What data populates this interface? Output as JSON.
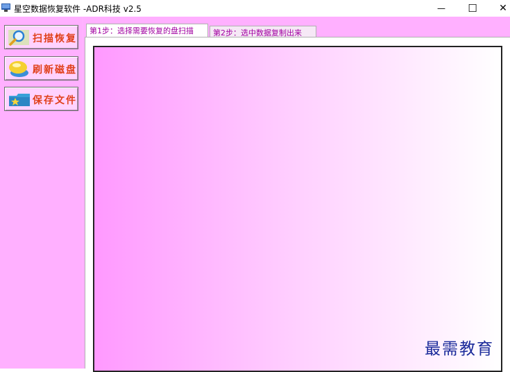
{
  "window": {
    "title": "星空数据恢复软件   -ADR科技 v2.5",
    "minimize_glyph": "—",
    "maximize_glyph": "☐",
    "close_glyph": "✕"
  },
  "sidebar": {
    "buttons": [
      {
        "label": "扫描恢复",
        "icon": "magnifier-icon"
      },
      {
        "label": "刷新磁盘",
        "icon": "disk-refresh-icon"
      },
      {
        "label": "保存文件",
        "icon": "folder-save-icon"
      }
    ]
  },
  "tabs": [
    {
      "label": "第1步：选择需要恢复的盘扫描",
      "active": true
    },
    {
      "label": "第2步：选中数据复制出来",
      "active": false
    }
  ],
  "watermark": "最需教育",
  "colors": {
    "accent_text": "#a000a0",
    "button_label": "#e0401a",
    "background": "#ffb0ff"
  }
}
